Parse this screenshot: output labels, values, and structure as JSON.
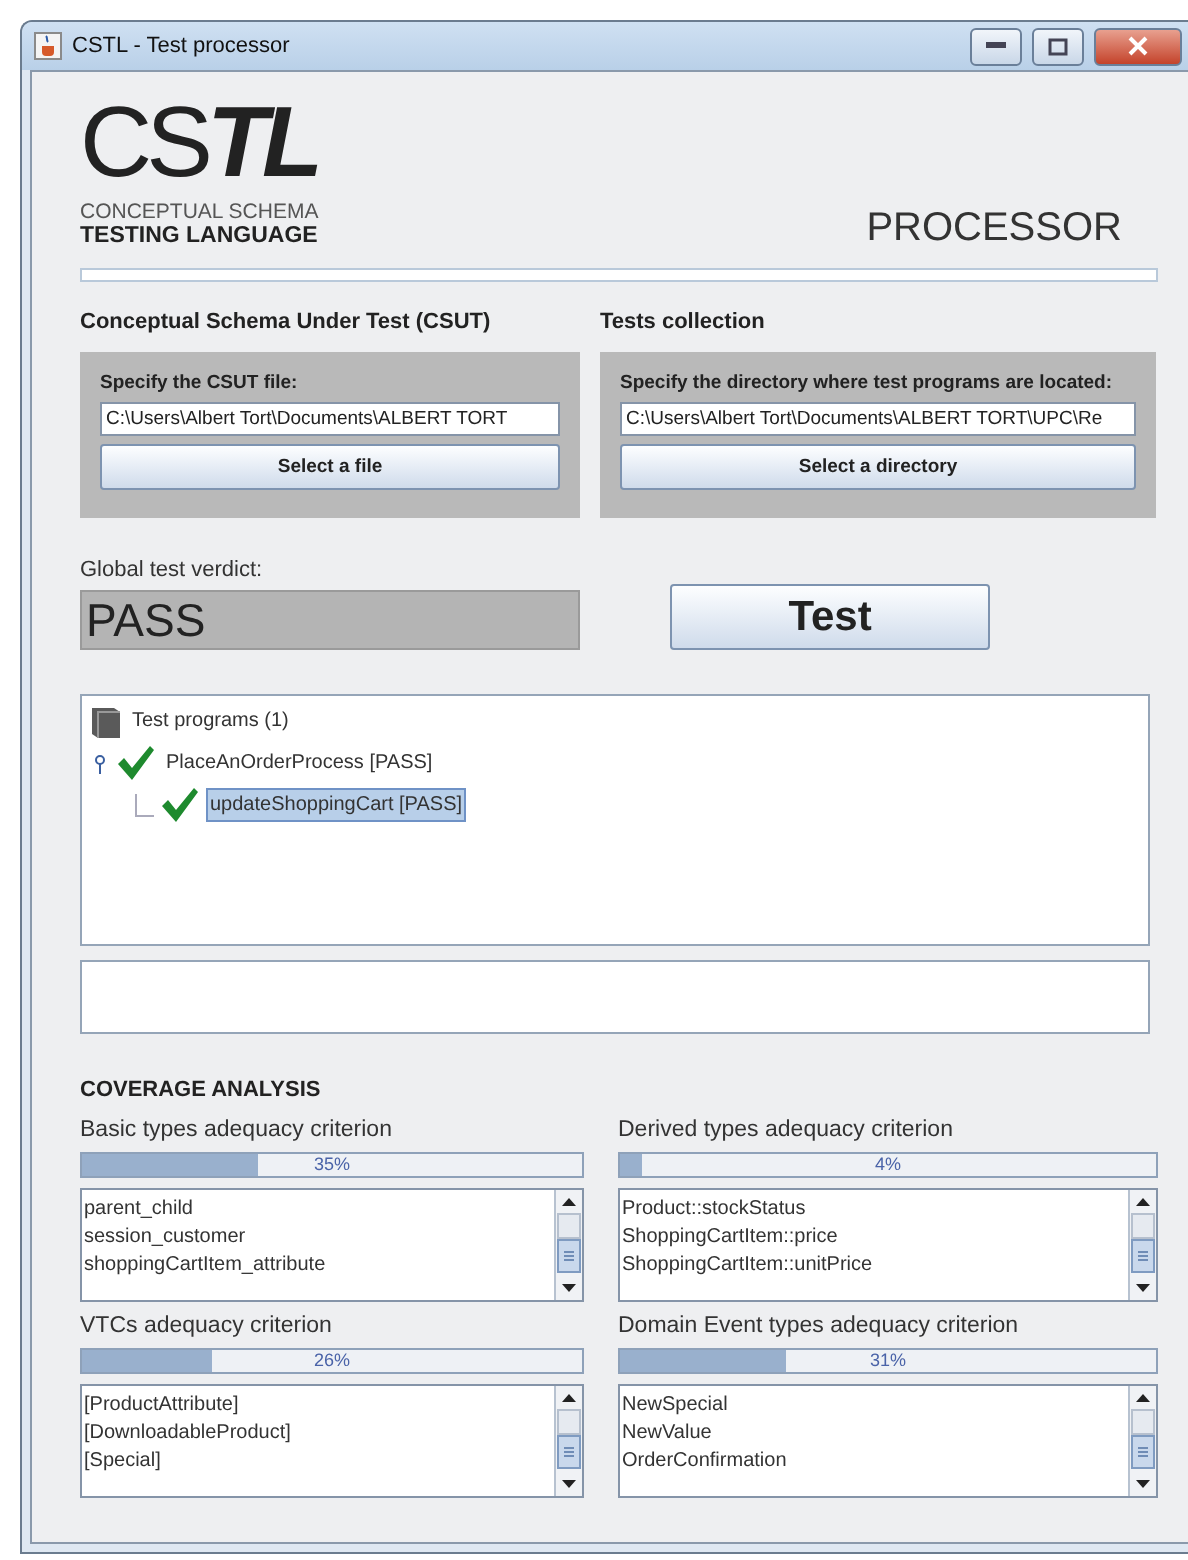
{
  "window": {
    "title": "CSTL - Test processor"
  },
  "logo": {
    "mark": "CS**TL**",
    "line_1": "CONCEPTUAL SCHEMA",
    "line_2": "TESTING LANGUAGE"
  },
  "heading": "PROCESSOR",
  "csut": {
    "title": "Conceptual Schema Under Test (CSUT)",
    "label": "Specify the CSUT file:",
    "value": "C:\\Users\\Albert Tort\\Documents\\ALBERT TORT",
    "button": "Select a file"
  },
  "tests": {
    "title": "Tests collection",
    "label": "Specify the directory where test programs are located:",
    "value": "C:\\Users\\Albert Tort\\Documents\\ALBERT TORT\\UPC\\Re",
    "button": "Select a directory"
  },
  "verdict": {
    "label": "Global test verdict:",
    "value": "PASS"
  },
  "test_button": "Test",
  "tree": [
    {
      "label": "Test programs (1)",
      "kind": "root",
      "selected": false,
      "children": [
        {
          "label": "PlaceAnOrderProcess [PASS]",
          "kind": "pass",
          "selected": false,
          "expanded": true,
          "children": [
            {
              "label": "updateShoppingCart [PASS]",
              "kind": "pass",
              "selected": true
            }
          ]
        }
      ]
    }
  ],
  "coverage": {
    "title": "COVERAGE ANALYSIS",
    "criteria": [
      {
        "title": "Basic types adequacy criterion",
        "level": 0.35,
        "reading": "35%",
        "items": [
          "parent_child",
          "session_customer",
          "shoppingCartItem_attribute"
        ]
      },
      {
        "title": "Derived types adequacy criterion",
        "level": 0.04,
        "reading": "4%",
        "items": [
          "Product::stockStatus",
          "ShoppingCartItem::price",
          "ShoppingCartItem::unitPrice"
        ]
      },
      {
        "title": "VTCs adequacy criterion",
        "level": 0.26,
        "reading": "26%",
        "items": [
          "[ProductAttribute]",
          "[DownloadableProduct]",
          "[Special]"
        ]
      },
      {
        "title": "Domain Event types adequacy criterion",
        "level": 0.31,
        "reading": "31%",
        "items": [
          "NewSpecial",
          "NewValue",
          "OrderConfirmation"
        ]
      }
    ]
  }
}
